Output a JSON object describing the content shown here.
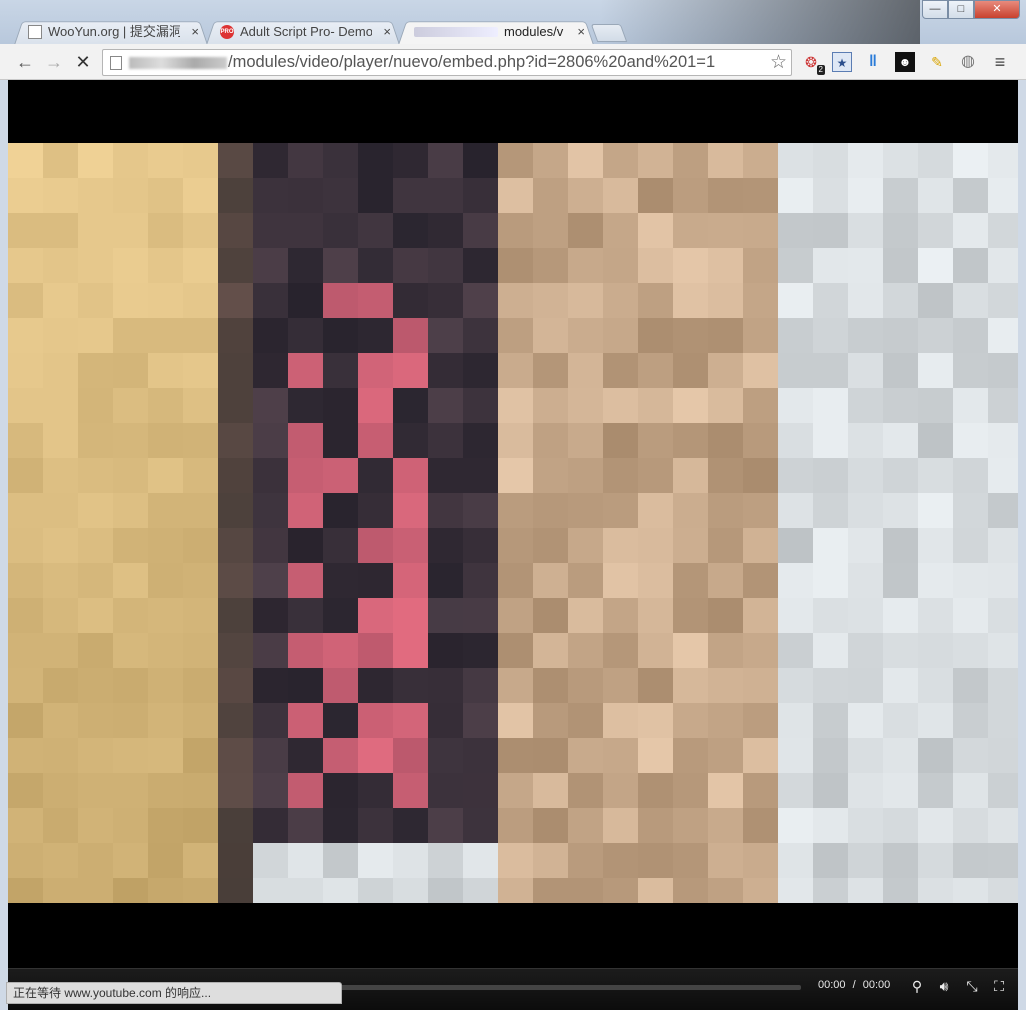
{
  "window": {
    "minimize_label": "—",
    "maximize_label": "□",
    "close_label": "✕"
  },
  "tabs": [
    {
      "title": "WooYun.org | 提交漏洞",
      "icon": "document-icon",
      "close": "×",
      "active": false
    },
    {
      "title": "Adult Script Pro- Demo",
      "icon": "pro-logo-icon",
      "close": "×",
      "active": false
    },
    {
      "title": "modules/v",
      "icon": "blurred-favicon",
      "close": "×",
      "active": true
    }
  ],
  "toolbar": {
    "back": "←",
    "forward": "→",
    "stop": "✕",
    "url_path": "/modules/video/player/nuevo/embed.php?id=2806%20and%201=1",
    "bookmark_star": "☆"
  },
  "extensions": [
    {
      "name": "extension-badge-icon",
      "badge": "2"
    },
    {
      "name": "bookmark-extension-icon"
    },
    {
      "name": "pause-extension-icon"
    },
    {
      "name": "mask-extension-icon"
    },
    {
      "name": "ghost-extension-icon"
    },
    {
      "name": "globe-extension-icon"
    },
    {
      "name": "menu-icon"
    }
  ],
  "player": {
    "current_time": "00:00",
    "separator": "/",
    "duration": "00:00"
  },
  "status": {
    "text": "正在等待 www.youtube.com 的响应..."
  },
  "colors": {
    "tabstrip": "#c9d6e6",
    "player_bg": "#000000",
    "controls_bg": "#141414"
  }
}
